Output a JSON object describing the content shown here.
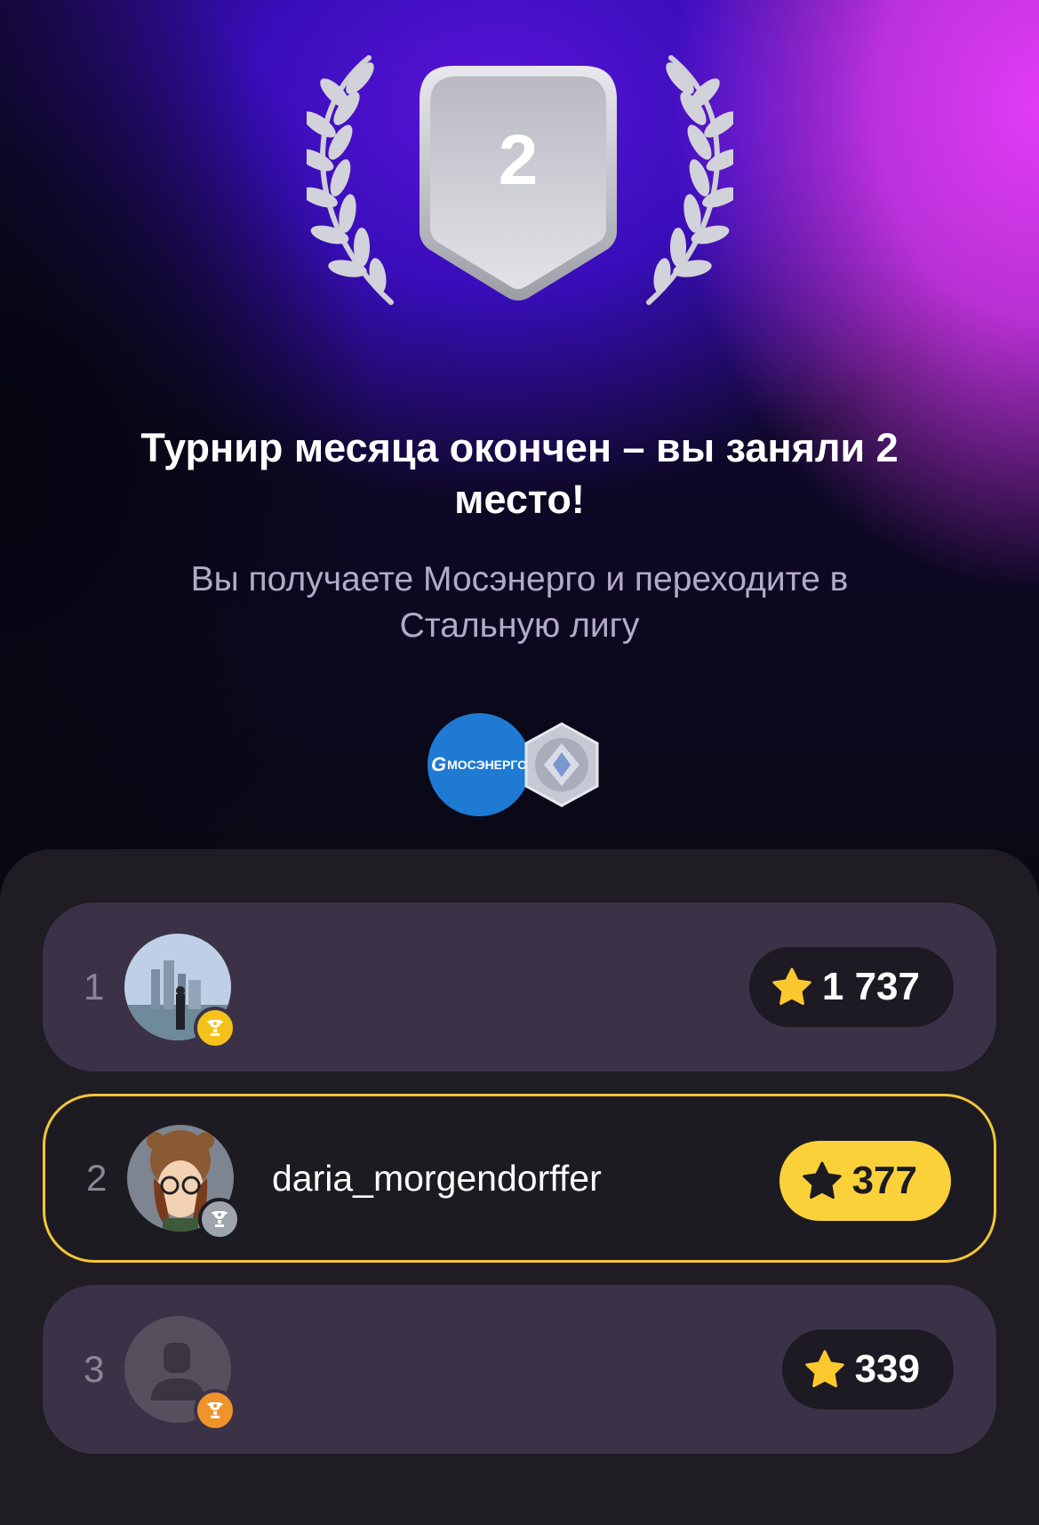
{
  "header": {
    "place_number": "2",
    "headline": "Турнир месяца окончен – вы заняли 2 место!",
    "subline": "Вы получаете Мосэнерго и переходите в Стальную лигу",
    "prize_logo_text": "МОСЭНЕРГО",
    "prize_logo_mark": "G"
  },
  "leaderboard": [
    {
      "rank": "1",
      "username": "",
      "score": "1 737",
      "cup": "gold-cup-icon",
      "is_me": false
    },
    {
      "rank": "2",
      "username": "daria_morgendorffer",
      "score": "377",
      "cup": "silver-cup-icon",
      "is_me": true
    },
    {
      "rank": "3",
      "username": "",
      "score": "339",
      "cup": "bronze-cup-icon",
      "is_me": false
    }
  ],
  "colors": {
    "accent_yellow": "#fbd13a",
    "gold_cup": "#f5c21b",
    "silver_cup": "#9ea4ad",
    "bronze_cup": "#f0932b",
    "row_bg": "#3b3248",
    "panel_bg": "#1f1c23",
    "brand_blue": "#1f7ad3"
  }
}
